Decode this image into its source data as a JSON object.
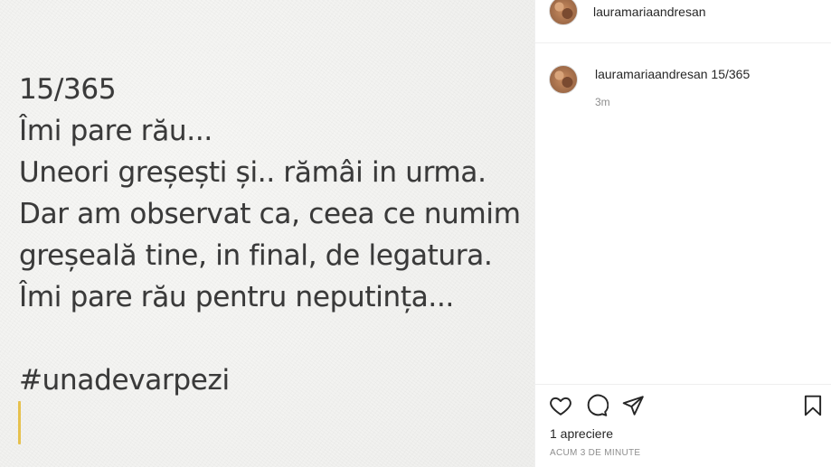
{
  "post": {
    "lines": [
      "15/365",
      "Îmi pare rău...",
      "Uneori greșești și.. rămâi in urma.",
      "Dar am observat ca, ceea ce numim",
      "greșeală tine, in final, de legatura.",
      "Îmi pare rău pentru neputința...",
      "",
      "#unadevarpezi"
    ],
    "cursor_color": "#e6c14e"
  },
  "header": {
    "username": "lauramariaandresan"
  },
  "comment": {
    "username": "lauramariaandresan",
    "text": "15/365",
    "time": "3m"
  },
  "actions": {
    "like_icon": "heart-icon",
    "comment_icon": "comment-bubble-icon",
    "share_icon": "paper-plane-icon",
    "save_icon": "bookmark-icon",
    "likes": "1 apreciere",
    "timestamp": "ACUM 3 DE MINUTE"
  }
}
